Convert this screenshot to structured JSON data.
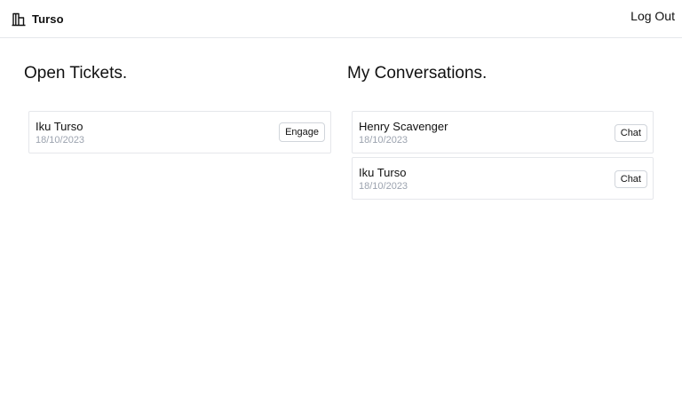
{
  "header": {
    "brand": "Turso",
    "brand_icon": "building-icon",
    "logout_label": "Log Out"
  },
  "open_tickets": {
    "title": "Open Tickets.",
    "items": [
      {
        "name": "Iku Turso",
        "date": "18/10/2023",
        "action": "Engage"
      }
    ]
  },
  "conversations": {
    "title": "My Conversations.",
    "items": [
      {
        "name": "Henry Scavenger",
        "date": "18/10/2023",
        "action": "Chat"
      },
      {
        "name": "Iku Turso",
        "date": "18/10/2023",
        "action": "Chat"
      }
    ]
  },
  "colors": {
    "border": "#e5e7eb",
    "muted_text": "#9ca3af",
    "text": "#111111"
  }
}
